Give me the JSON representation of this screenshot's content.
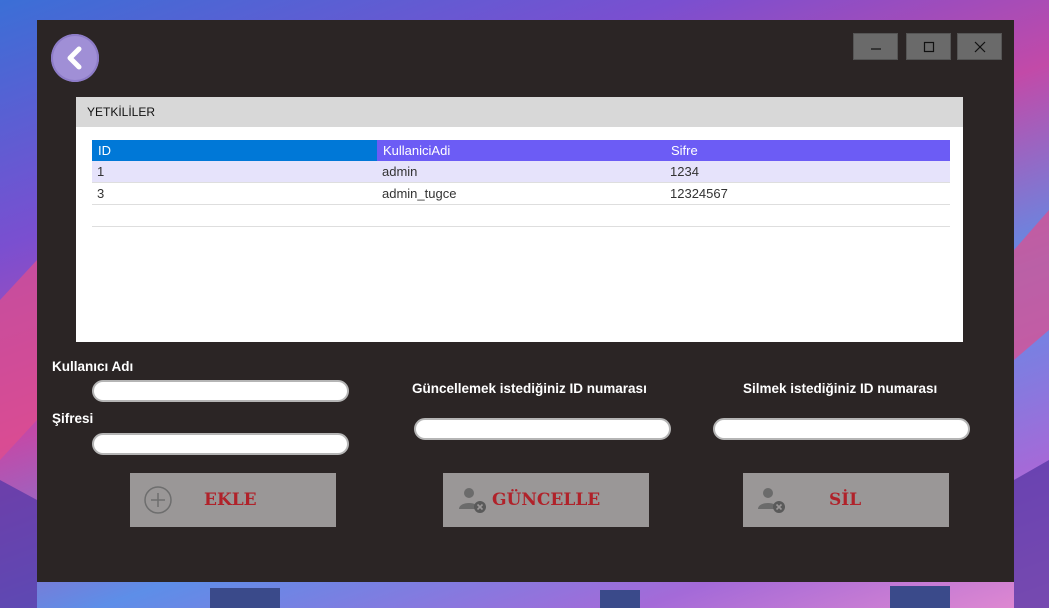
{
  "window": {
    "controls": {
      "minimize_icon": "minimize-icon",
      "maximize_icon": "maximize-icon",
      "close_icon": "close-icon"
    },
    "back_icon": "back-arrow-icon"
  },
  "panel": {
    "title": "YETKİLİLER",
    "columns": [
      "ID",
      "KullaniciAdi",
      "Sifre"
    ],
    "rows": [
      [
        "1",
        "admin",
        "1234"
      ],
      [
        "3",
        "admin_tugce",
        "12324567"
      ],
      [
        "",
        "",
        ""
      ]
    ]
  },
  "form": {
    "username_label": "Kullanıcı Adı",
    "password_label": "Şifresi",
    "update_label": "Güncellemek istediğiniz ID numarası",
    "delete_label": "Silmek istediğiniz ID numarası",
    "username_value": "",
    "password_value": "",
    "update_id_value": "",
    "delete_id_value": ""
  },
  "buttons": {
    "add": "EKLE",
    "update": "GÜNCELLE",
    "delete": "SİL"
  },
  "colors": {
    "window_bg": "#2b2525",
    "header_id": "#0078d7",
    "header_cols": "#6c5cf5",
    "button_bg": "#9a9797",
    "button_text": "#b0222a"
  }
}
